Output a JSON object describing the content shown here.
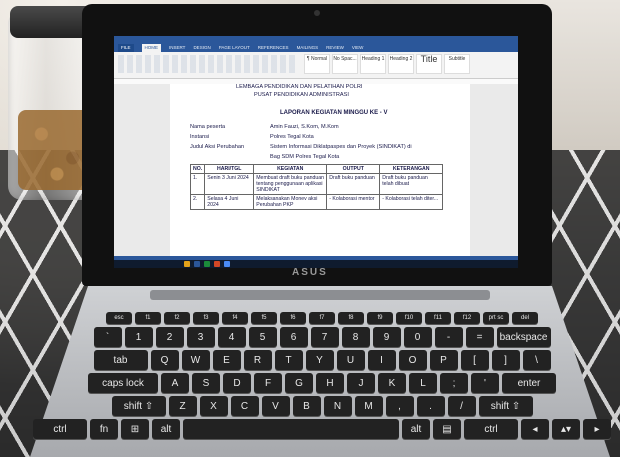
{
  "word": {
    "tabs": [
      "FILE",
      "HOME",
      "INSERT",
      "DESIGN",
      "PAGE LAYOUT",
      "REFERENCES",
      "MAILINGS",
      "REVIEW",
      "VIEW"
    ],
    "active_tab": "HOME",
    "styles": [
      "¶ Normal",
      "No Spac...",
      "Heading 1",
      "Heading 2",
      "Title",
      "Subtitle"
    ]
  },
  "document": {
    "header_line1": "LEMBAGA PENDIDIKAN DAN PELATIHAN POLRI",
    "header_line2": "PUSAT PENDIDIKAN ADMINISTRASI",
    "title": "LAPORAN KEGIATAN MINGGU KE - V",
    "fields": [
      {
        "label": "Nama peserta",
        "value": "Amin Fauzi, S.Kom, M.Kom"
      },
      {
        "label": "Instansi",
        "value": "Polres Tegal Kota"
      },
      {
        "label": "Judul Aksi Perubahan",
        "value": "Sistem Informasi Diklatpaspes dan Proyek (SINDIKAT) di"
      },
      {
        "label": "",
        "value": "Bag SDM Polres Tegal Kota"
      }
    ],
    "table": {
      "headers": [
        "NO.",
        "HARI/TGL",
        "KEGIATAN",
        "OUTPUT",
        "KETERANGAN"
      ],
      "rows": [
        [
          "1.",
          "Senin 3 Juni 2024",
          "Membuat draft buku panduan tentang penggunaan aplikasi SINDIKAT",
          "Draft buku panduan",
          "Draft buku panduan telah dibuat"
        ],
        [
          "2.",
          "Selasa 4 Juni 2024",
          "Melaksanakan Monev aksi Perubahan PKP",
          "- Kolaborasi mentor",
          "- Kolaborasi telah diter..."
        ]
      ]
    }
  },
  "brand": "ASUS",
  "keyboard": {
    "rows": [
      [
        "esc",
        "f1",
        "f2",
        "f3",
        "f4",
        "f5",
        "f6",
        "f7",
        "f8",
        "f9",
        "f10",
        "f11",
        "f12",
        "prt sc",
        "del"
      ],
      [
        "`",
        "1",
        "2",
        "3",
        "4",
        "5",
        "6",
        "7",
        "8",
        "9",
        "0",
        "-",
        "=",
        "backspace"
      ],
      [
        "tab",
        "Q",
        "W",
        "E",
        "R",
        "T",
        "Y",
        "U",
        "I",
        "O",
        "P",
        "[",
        "]",
        "\\"
      ],
      [
        "caps lock",
        "A",
        "S",
        "D",
        "F",
        "G",
        "H",
        "J",
        "K",
        "L",
        ";",
        "'",
        "enter"
      ],
      [
        "shift ⇧",
        "Z",
        "X",
        "C",
        "V",
        "B",
        "N",
        "M",
        ",",
        ".",
        "/",
        "shift ⇧"
      ],
      [
        "ctrl",
        "fn",
        "⊞",
        "alt",
        "",
        "alt",
        "▤",
        "ctrl",
        "◂",
        "▴▾",
        "▸"
      ]
    ]
  }
}
